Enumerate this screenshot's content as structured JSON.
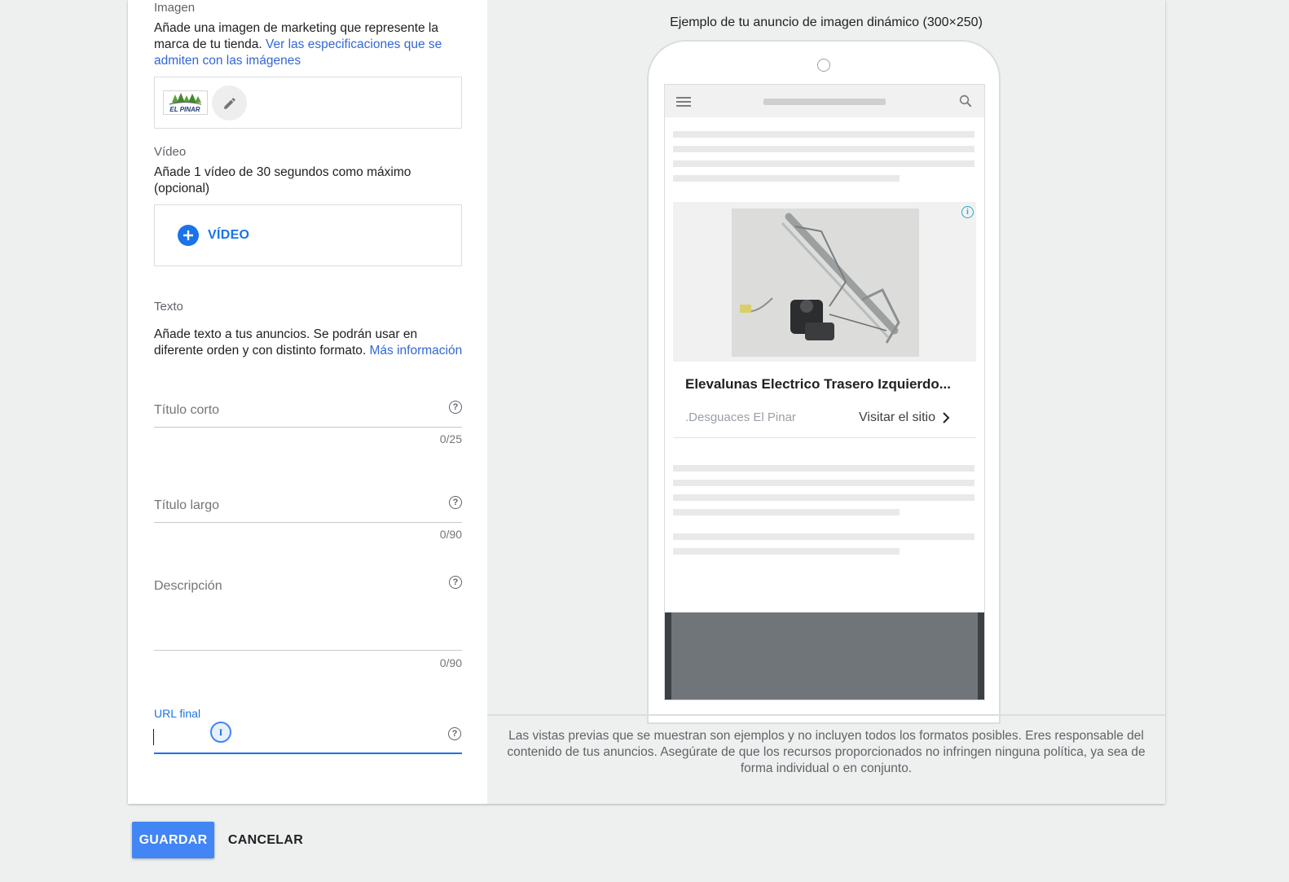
{
  "form": {
    "image": {
      "label": "Imagen",
      "description": "Añade una imagen de marketing que represente la marca de tu tienda.",
      "link": "Ver las especificaciones que se admiten con las imágenes",
      "logo_text": "EL PINAR"
    },
    "video": {
      "label": "Vídeo",
      "description": "Añade 1 vídeo de 30 segundos como máximo (opcional)",
      "add_button": "VÍDEO"
    },
    "text": {
      "label": "Texto",
      "description": "Añade texto a tus anuncios. Se podrán usar en diferente orden y con distinto formato.",
      "link": "Más información"
    },
    "fields": {
      "short_title": {
        "label": "Título corto",
        "counter": "0/25"
      },
      "long_title": {
        "label": "Título largo",
        "counter": "0/90"
      },
      "description": {
        "label": "Descripción",
        "counter": "0/90"
      },
      "final_url": {
        "label": "URL final",
        "value": ""
      }
    },
    "help_glyph": "?"
  },
  "preview": {
    "title": "Ejemplo de tu anuncio de imagen dinámico (300×250)",
    "ad": {
      "headline": "Elevalunas Electrico Trasero Izquierdo...",
      "advertiser": ".Desguaces El Pinar",
      "cta": "Visitar el sitio",
      "info_glyph": "i"
    },
    "disclaimer": "Las vistas previas que se muestran son ejemplos y no incluyen todos los formatos posibles. Eres responsable del contenido de tus anuncios. Asegúrate de que los recursos proporcionados no infringen ninguna política, ya sea de forma individual o en conjunto."
  },
  "actions": {
    "save": "GUARDAR",
    "cancel": "CANCELAR"
  },
  "icons": {
    "edit": "pencil-icon",
    "add": "plus-circle-icon",
    "help": "question-circle-icon",
    "menu": "hamburger-icon",
    "search": "search-icon",
    "chevron": "chevron-right-icon",
    "info": "info-icon"
  },
  "colors": {
    "accent": "#1a73e8",
    "primary_button": "#4285f4",
    "link": "#3367d6",
    "page_bg": "#edf0ef"
  }
}
